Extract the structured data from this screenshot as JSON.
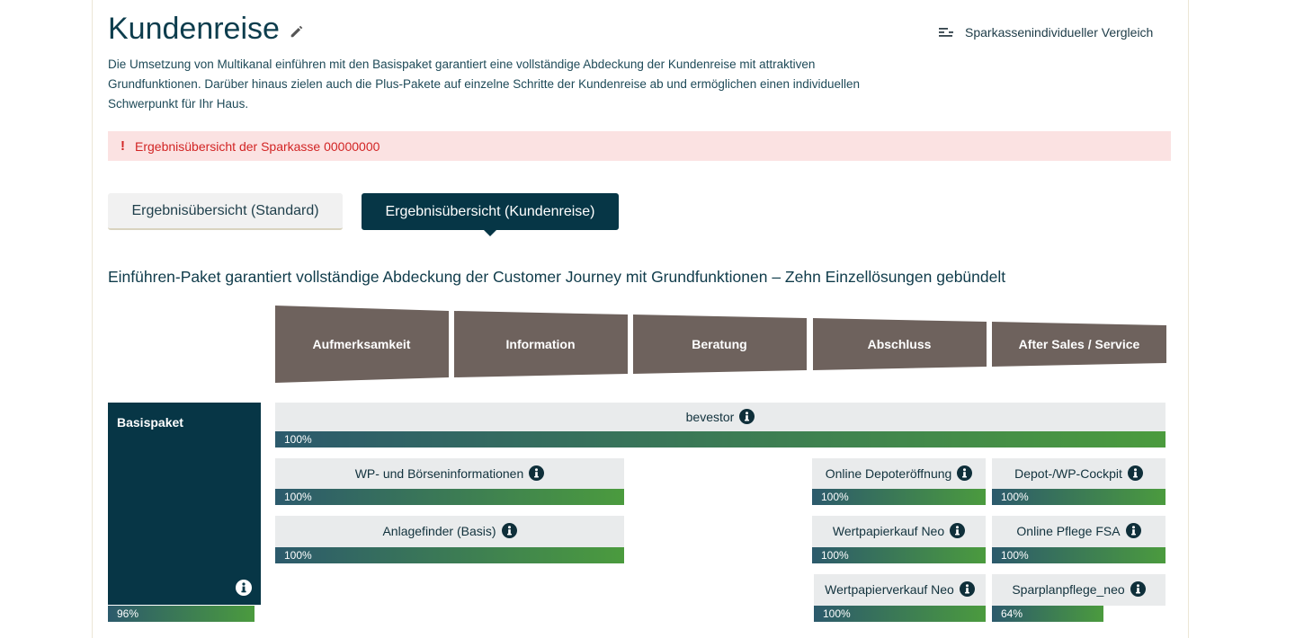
{
  "header": {
    "title": "Kundenreise",
    "compare_link": "Sparkassenindividueller Vergleich"
  },
  "description": "Die Umsetzung von Multikanal einführen mit den Basispaket garantiert eine vollständige Abdeckung der Kundenreise mit attraktiven Grundfunktionen. Darüber hinaus zielen auch die Plus-Pakete auf einzelne Schritte der Kundenreise ab und ermöglichen einen individuellen Schwerpunkt für Ihr Haus.",
  "alert": {
    "icon": "!",
    "text": "Ergebnisübersicht der Sparkasse 00000000"
  },
  "tabs": [
    {
      "label": "Ergebnisübersicht (Standard)",
      "active": false
    },
    {
      "label": "Ergebnisübersicht (Kundenreise)",
      "active": true
    }
  ],
  "section_heading": "Einführen-Paket garantiert vollständige Abdeckung der Customer Journey mit Grundfunktionen – Zehn Einzellösungen gebündelt",
  "journey_stages": [
    "Aufmerksamkeit",
    "Information",
    "Beratung",
    "Abschluss",
    "After Sales / Service"
  ],
  "package": {
    "label": "Basispaket",
    "percent_label": "96%",
    "percent": 96
  },
  "products": {
    "bevestor": {
      "name": "bevestor",
      "percent_label": "100%",
      "percent": 100
    },
    "wp_boerse": {
      "name": "WP- und Börseninformationen",
      "percent_label": "100%",
      "percent": 100
    },
    "anlagefinder": {
      "name": "Anlagefinder (Basis)",
      "percent_label": "100%",
      "percent": 100
    },
    "depoteroeffnung": {
      "name": "Online Depoteröffnung",
      "percent_label": "100%",
      "percent": 100
    },
    "depot_cockpit": {
      "name": "Depot-/WP-Cockpit",
      "percent_label": "100%",
      "percent": 100
    },
    "wp_kauf": {
      "name": "Wertpapierkauf Neo",
      "percent_label": "100%",
      "percent": 100
    },
    "pflege_fsa": {
      "name": "Online Pflege FSA",
      "percent_label": "100%",
      "percent": 100
    },
    "wp_verkauf": {
      "name": "Wertpapierverkauf Neo",
      "percent_label": "100%",
      "percent": 100
    },
    "sparplan": {
      "name": "Sparplanpflege_neo",
      "percent_label": "64%",
      "percent": 64
    }
  },
  "colors": {
    "dark_teal": "#063646",
    "stage_brown": "#6e625d",
    "alert_bg": "#fbe2e2",
    "alert_text": "#d22525",
    "bar_start": "#2c5a6c",
    "bar_end": "#4b9b3e"
  },
  "icons": {
    "edit": "pencil-icon",
    "compare": "list-compare-icon",
    "info": "info-icon"
  }
}
